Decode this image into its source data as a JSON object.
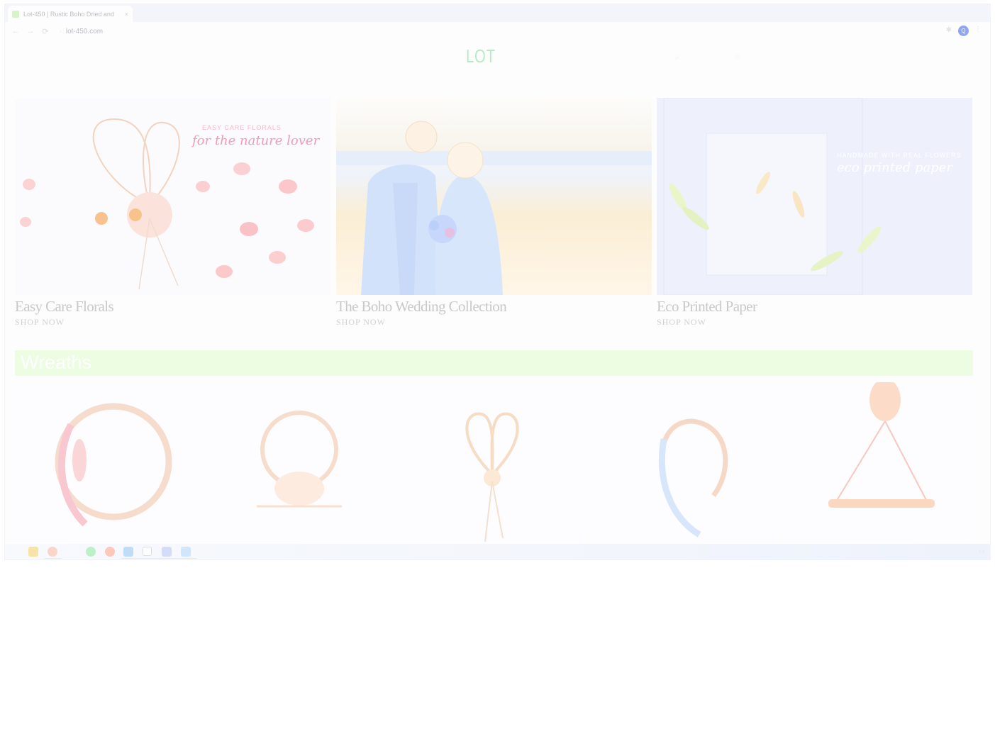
{
  "browser": {
    "tab_title": "Lot-450 | Rustic Boho Dried and",
    "tab_close": "×",
    "url": "lot-450.com",
    "nav_back": "←",
    "nav_forward": "→",
    "nav_reload": "⟳",
    "lock": "🔒",
    "ext": "✱",
    "profile_initial": "Q",
    "menu": "⋮"
  },
  "site": {
    "logo": "LOT",
    "header_icons": [
      "⌕",
      "♡"
    ],
    "nav": [
      "",
      "",
      "",
      "",
      "",
      "",
      "",
      "",
      ""
    ]
  },
  "banners": [
    {
      "title": "Easy Care Florals",
      "cta": "SHOP NOW",
      "overlay_small": "EASY CARE FLORALS",
      "overlay_script": "for the nature lover"
    },
    {
      "title": "The Boho Wedding Collection",
      "cta": "SHOP NOW",
      "overlay_small": "",
      "overlay_script": ""
    },
    {
      "title": "Eco Printed Paper",
      "cta": "SHOP NOW",
      "overlay_small": "HANDMADE WITH REAL FLOWERS",
      "overlay_script": "eco printed paper"
    }
  ],
  "section": {
    "title": "Wreaths"
  },
  "products": [
    {
      "name": "wreath-1"
    },
    {
      "name": "wreath-2"
    },
    {
      "name": "wreath-3"
    },
    {
      "name": "wreath-4"
    },
    {
      "name": "wreath-5"
    }
  ],
  "taskbar": {
    "icons": [
      "home",
      "chrome",
      "spotify",
      "firefox",
      "vscode",
      "app",
      "laptop",
      "photoshop"
    ]
  },
  "colors": {
    "brand": "#b6ebc4",
    "section_bar": "#ecfde2",
    "profile": "#8ea6f4"
  }
}
